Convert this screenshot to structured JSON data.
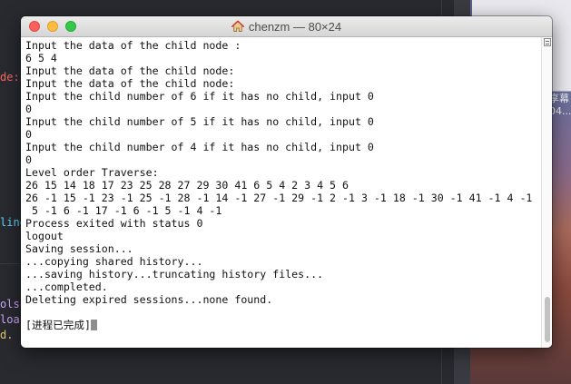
{
  "window": {
    "title": "chenzm — 80×24",
    "title_icon": "home-icon"
  },
  "terminal": {
    "lines": [
      "Input the data of the child node :",
      "6 5 4",
      "Input the data of the child node:",
      "Input the data of the child node:",
      "Input the child number of 6 if it has no child, input 0",
      "0",
      "Input the child number of 5 if it has no child, input 0",
      "0",
      "Input the child number of 4 if it has no child, input 0",
      "0",
      "Level order Traverse:",
      "26 15 14 18 17 23 25 28 27 29 30 41 6 5 4 2 3 4 5 6",
      "26 -1 15 -1 23 -1 25 -1 28 -1 14 -1 27 -1 29 -1 2 -1 3 -1 18 -1 30 -1 41 -1 4 -1",
      " 5 -1 6 -1 17 -1 6 -1 5 -1 4 -1",
      "Process exited with status 0",
      "logout",
      "Saving session...",
      "...copying shared history...",
      "...saving history...truncating history files...",
      "...completed.",
      "Deleting expired sessions...none found.",
      "",
      "[进程已完成]"
    ]
  },
  "background_editor": {
    "frag_node": "de:",
    "frag_ling": "ling",
    "frag_ols": "ols",
    "frag_loa": "loa",
    "frag_dot": "d."
  },
  "background_desktop": {
    "frag_a": "享幕",
    "frag_b": "04..."
  },
  "colors": {
    "close": "#fc605c",
    "minimize": "#fdbc40",
    "zoom": "#34c84a",
    "terminal_bg": "#ffffff",
    "terminal_text": "#111111"
  }
}
